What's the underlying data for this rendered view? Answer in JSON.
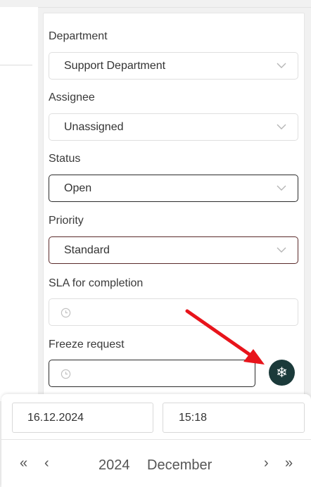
{
  "form": {
    "department": {
      "label": "Department",
      "value": "Support Department"
    },
    "assignee": {
      "label": "Assignee",
      "value": "Unassigned"
    },
    "status": {
      "label": "Status",
      "value": "Open"
    },
    "priority": {
      "label": "Priority",
      "value": "Standard"
    },
    "sla": {
      "label": "SLA for completion",
      "value": ""
    },
    "freeze": {
      "label": "Freeze request",
      "value": ""
    },
    "freeze_button_glyph": "❄"
  },
  "datepicker": {
    "date": "16.12.2024",
    "time": "15:18",
    "year": "2024",
    "month": "December",
    "nav_prev_year": "«",
    "nav_prev_month": "‹",
    "nav_next_month": "›",
    "nav_next_year": "»"
  },
  "icons": {
    "dropdown": "chevron-down-icon",
    "clock": "clock-icon",
    "freeze": "snowflake-icon",
    "annotation": "red-arrow"
  },
  "colors": {
    "freeze_button": "#1b3a3a",
    "annotation_arrow": "#e8141b"
  }
}
